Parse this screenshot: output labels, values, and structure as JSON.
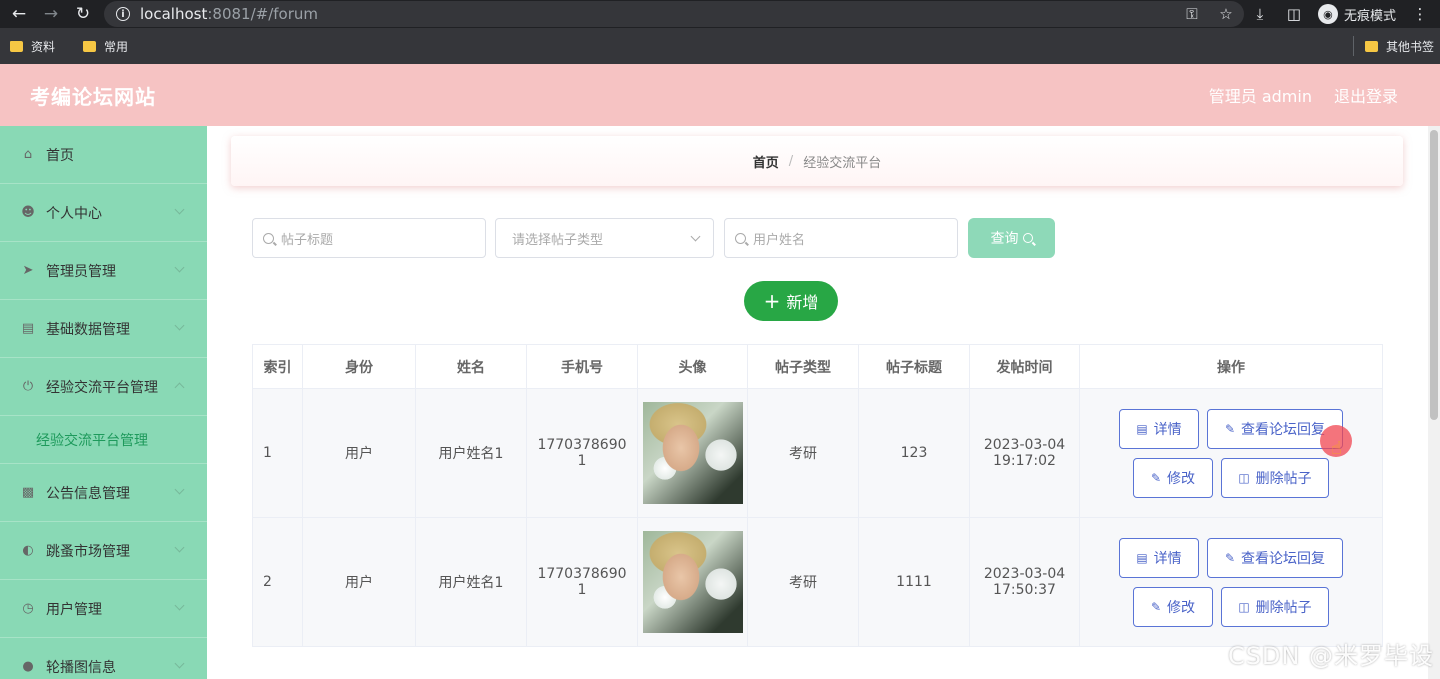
{
  "browser": {
    "url_host": "localhost",
    "url_rest": ":8081/#/forum",
    "incognito_label": "无痕模式",
    "bookmarks": [
      "资料",
      "常用"
    ],
    "other_bookmarks": "其他书签"
  },
  "header": {
    "title": "考编论坛网站",
    "user_label": "管理员 admin",
    "logout_label": "退出登录"
  },
  "sidebar": {
    "items": [
      {
        "label": "首页",
        "icon": "home-icon"
      },
      {
        "label": "个人中心",
        "icon": "user-icon"
      },
      {
        "label": "管理员管理",
        "icon": "send-icon"
      },
      {
        "label": "基础数据管理",
        "icon": "brush-icon"
      },
      {
        "label": "经验交流平台管理",
        "icon": "power-icon"
      },
      {
        "label": "经验交流平台管理"
      },
      {
        "label": "公告信息管理",
        "icon": "notice-icon"
      },
      {
        "label": "跳蚤市场管理",
        "icon": "gauge-icon"
      },
      {
        "label": "用户管理",
        "icon": "clock-icon"
      },
      {
        "label": "轮播图信息",
        "icon": "mic-icon"
      }
    ]
  },
  "breadcrumb": {
    "home": "首页",
    "separator": "/",
    "current": "经验交流平台"
  },
  "search": {
    "title_placeholder": "帖子标题",
    "type_placeholder": "请选择帖子类型",
    "username_placeholder": "用户姓名",
    "query_label": "查询"
  },
  "add_label": "新增",
  "table": {
    "columns": [
      "索引",
      "身份",
      "姓名",
      "手机号",
      "头像",
      "帖子类型",
      "帖子标题",
      "发帖时间",
      "操作"
    ],
    "rows": [
      {
        "index": "1",
        "role": "用户",
        "name": "用户姓名1",
        "phone_a": "1770378690",
        "phone_b": "1",
        "type": "考研",
        "title": "123",
        "date": "2023-03-04",
        "time": "19:17:02"
      },
      {
        "index": "2",
        "role": "用户",
        "name": "用户姓名1",
        "phone_a": "1770378690",
        "phone_b": "1",
        "type": "考研",
        "title": "1111",
        "date": "2023-03-04",
        "time": "17:50:37"
      }
    ],
    "actions": {
      "detail": "详情",
      "view_replies": "查看论坛回复",
      "edit": "修改",
      "delete": "删除帖子"
    }
  },
  "watermark": "CSDN @米罗毕设"
}
